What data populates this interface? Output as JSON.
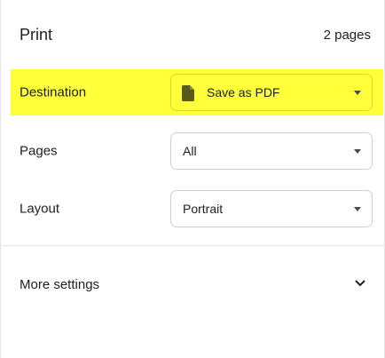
{
  "header": {
    "title": "Print",
    "page_count": "2 pages"
  },
  "settings": {
    "destination": {
      "label": "Destination",
      "value": "Save as PDF",
      "icon": "document-icon"
    },
    "pages": {
      "label": "Pages",
      "value": "All"
    },
    "layout": {
      "label": "Layout",
      "value": "Portrait"
    }
  },
  "more_settings": {
    "label": "More settings",
    "icon": "chevron-down-icon"
  },
  "colors": {
    "highlight": "#ffff3a",
    "text": "#202124",
    "border": "#cfcfcf"
  }
}
